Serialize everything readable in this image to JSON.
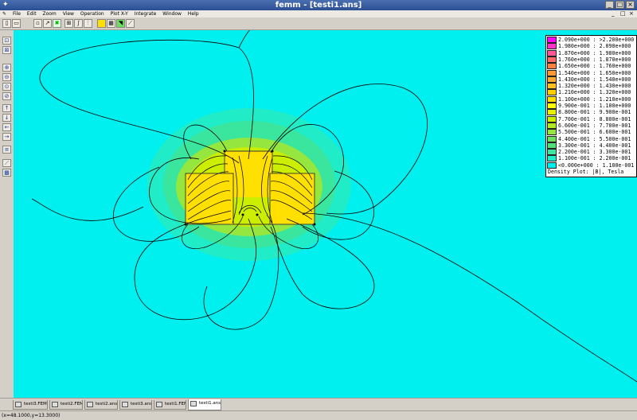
{
  "window": {
    "title": "femm - [testi1.ans]"
  },
  "menu": [
    "File",
    "Edit",
    "Zoom",
    "View",
    "Operation",
    "Plot X-Y",
    "Integrate",
    "Window",
    "Help"
  ],
  "legend": {
    "entries": [
      {
        "label": "2.090e+000 : >2.200e+000",
        "color": "#ff00ff"
      },
      {
        "label": "1.980e+000 : 2.090e+000",
        "color": "#ff33cc"
      },
      {
        "label": "1.870e+000 : 1.980e+000",
        "color": "#ff5599"
      },
      {
        "label": "1.760e+000 : 1.870e+000",
        "color": "#ff6b6b"
      },
      {
        "label": "1.650e+000 : 1.760e+000",
        "color": "#ff8040"
      },
      {
        "label": "1.540e+000 : 1.650e+000",
        "color": "#ff9a33"
      },
      {
        "label": "1.430e+000 : 1.540e+000",
        "color": "#ffaa33"
      },
      {
        "label": "1.320e+000 : 1.430e+000",
        "color": "#ffc020"
      },
      {
        "label": "1.210e+000 : 1.320e+000",
        "color": "#ffd000"
      },
      {
        "label": "1.100e+000 : 1.210e+000",
        "color": "#ffe000"
      },
      {
        "label": "9.900e-001 : 1.100e+000",
        "color": "#ffff00"
      },
      {
        "label": "8.800e-001 : 9.900e-001",
        "color": "#e6f000"
      },
      {
        "label": "7.700e-001 : 8.800e-001",
        "color": "#ccee00"
      },
      {
        "label": "6.600e-001 : 7.700e-001",
        "color": "#b0ea20"
      },
      {
        "label": "5.500e-001 : 6.600e-001",
        "color": "#96e640"
      },
      {
        "label": "4.400e-001 : 5.500e-001",
        "color": "#6ee060"
      },
      {
        "label": "3.300e-001 : 4.400e-001",
        "color": "#50e07a"
      },
      {
        "label": "2.200e-001 : 3.300e-001",
        "color": "#3ee4a0"
      },
      {
        "label": "1.100e-001 : 2.200e-001",
        "color": "#20ecc8"
      },
      {
        "label": "<0.000e+000 : 1.100e-001",
        "color": "#00f0f0"
      }
    ],
    "caption": "Density Plot: |B|, Tesla"
  },
  "tabs": [
    {
      "label": "testi3.FEM",
      "active": false
    },
    {
      "label": "testi2.FEM",
      "active": false
    },
    {
      "label": "testi2.ans",
      "active": false
    },
    {
      "label": "testi3.ans",
      "active": false
    },
    {
      "label": "testi1.FEM",
      "active": false
    },
    {
      "label": "testi1.ans",
      "active": true
    }
  ],
  "status": "(x=48.1000,y=13.3000)",
  "colors": {
    "background": "#00f0f0",
    "field_outer": "#20ecc8",
    "field_mid": "#6ee060",
    "field_high": "#ccee00",
    "field_core": "#ffe000"
  }
}
